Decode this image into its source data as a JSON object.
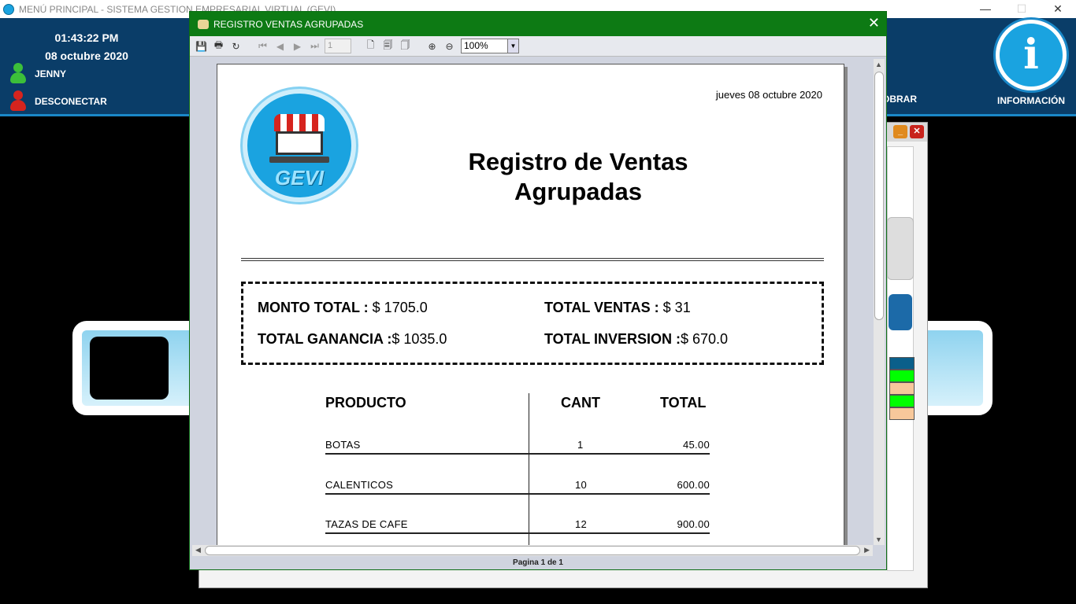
{
  "main_window": {
    "title": "MENÚ PRINCIPAL - SISTEMA GESTION EMPRESARIAL VIRTUAL (GEVI)",
    "controls": [
      "—",
      "☐",
      "✕"
    ]
  },
  "header": {
    "time": "01:43:22 PM",
    "date": "08 octubre 2020",
    "user": "JENNY",
    "logout": "DESCONECTAR",
    "cobrar_label": "OBRAR",
    "info_label": "INFORMACIÓN",
    "info_glyph": "i"
  },
  "dialog": {
    "title": "REGISTRO VENTAS AGRUPADAS",
    "close": "✕",
    "toolbar": {
      "page_input": "1",
      "zoom": "100%"
    },
    "status": "Pagina 1 de 1"
  },
  "report": {
    "date": "jueves 08 octubre 2020",
    "logo_text": "GEVI",
    "title_line1": "Registro de Ventas",
    "title_line2": "Agrupadas",
    "summary": {
      "monto_label": "MONTO TOTAL : ",
      "monto_value": "$ 1705.0",
      "ventas_label": "TOTAL VENTAS : ",
      "ventas_value": " $ 31",
      "ganancia_label": "TOTAL GANANCIA  :",
      "ganancia_value": "$ 1035.0",
      "inversion_label": "TOTAL INVERSION :",
      "inversion_value": "$ 670.0"
    },
    "columns": {
      "producto": "PRODUCTO",
      "cant": "CANT",
      "total": "TOTAL"
    },
    "rows": [
      {
        "producto": "BOTAS",
        "cant": "1",
        "total": "45.00"
      },
      {
        "producto": "CALENTICOS",
        "cant": "10",
        "total": "600.00"
      },
      {
        "producto": "TAZAS DE CAFE",
        "cant": "12",
        "total": "900.00"
      }
    ]
  },
  "colors": {
    "header_bg": "#0a3d68",
    "dialog_title_bg": "#0d7a14",
    "accent_blue": "#1aa3e0",
    "row_colors": [
      "#0a5f8a",
      "#00ff00",
      "#f7c89b",
      "#00ff00",
      "#f7c89b"
    ]
  }
}
